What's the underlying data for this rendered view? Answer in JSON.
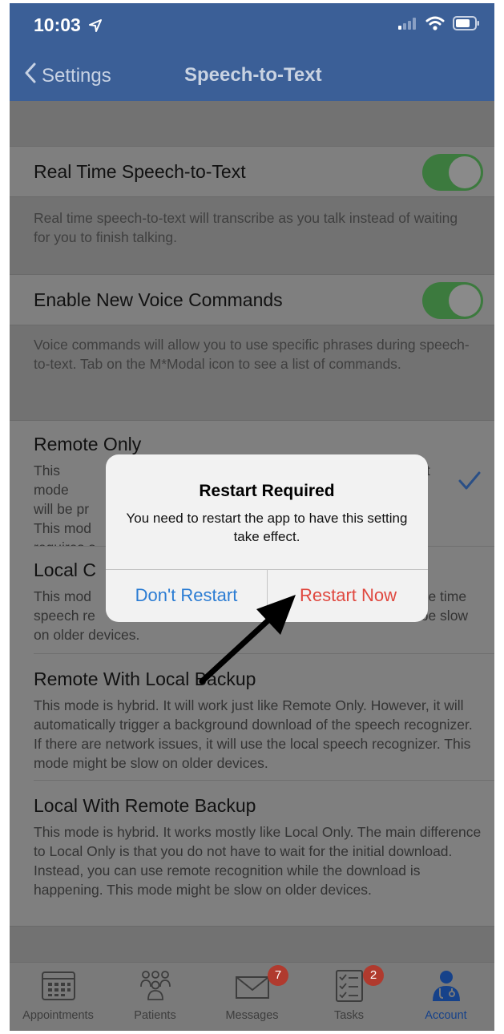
{
  "status_bar": {
    "time": "10:03"
  },
  "nav": {
    "back_label": "Settings",
    "title": "Speech-to-Text"
  },
  "settings": {
    "realtime": {
      "label": "Real Time Speech-to-Text",
      "enabled": true,
      "footer": "Real time speech-to-text will transcribe as you talk instead of waiting for you to finish talking."
    },
    "voice_commands": {
      "label": "Enable New Voice Commands",
      "enabled": true,
      "footer": "Voice commands will allow you to use specific phrases during speech-to-text. Tab on the M*Modal icon to see a list of commands."
    }
  },
  "modes": [
    {
      "title": "Remote Only",
      "visible_description_fragments": [
        "This mode",
        "will be pr",
        "This mod",
        "requires a"
      ],
      "visible_right_fragment": "t",
      "selected": true
    },
    {
      "title": "Local C",
      "visible_description_fragments": [
        "This mod",
        "speech re",
        "on older devices."
      ],
      "visible_right_fragments": [
        "one time",
        "t be slow"
      ]
    },
    {
      "title": "Remote With Local Backup",
      "description": "This mode is hybrid. It will work just like Remote Only. However, it will automatically trigger a background download of the speech recognizer. If there are network issues, it will use the local speech recognizer. This mode might be slow on older devices."
    },
    {
      "title": "Local With Remote Backup",
      "description": "This mode is hybrid. It works mostly like Local Only. The main difference to Local Only is that you do not have to wait for the initial download. Instead, you can use remote recognition while the download is happening. This mode might be slow on older devices."
    }
  ],
  "alert": {
    "title": "Restart Required",
    "message": "You need to restart the app to have this setting take effect.",
    "cancel_label": "Don't Restart",
    "confirm_label": "Restart Now"
  },
  "tab_bar": {
    "tabs": [
      {
        "label": "Appointments",
        "icon": "calendar-icon"
      },
      {
        "label": "Patients",
        "icon": "people-icon"
      },
      {
        "label": "Messages",
        "icon": "envelope-icon",
        "badge": "7"
      },
      {
        "label": "Tasks",
        "icon": "checklist-icon",
        "badge": "2"
      },
      {
        "label": "Account",
        "icon": "doctor-icon",
        "active": true
      }
    ]
  },
  "colors": {
    "nav_blue": "#3b5f97",
    "toggle_green": "#3c7a3e",
    "alert_blue": "#2b7cd3",
    "alert_red": "#e0483f",
    "badge_red": "#b03a2e",
    "active_tab": "#16428a"
  }
}
